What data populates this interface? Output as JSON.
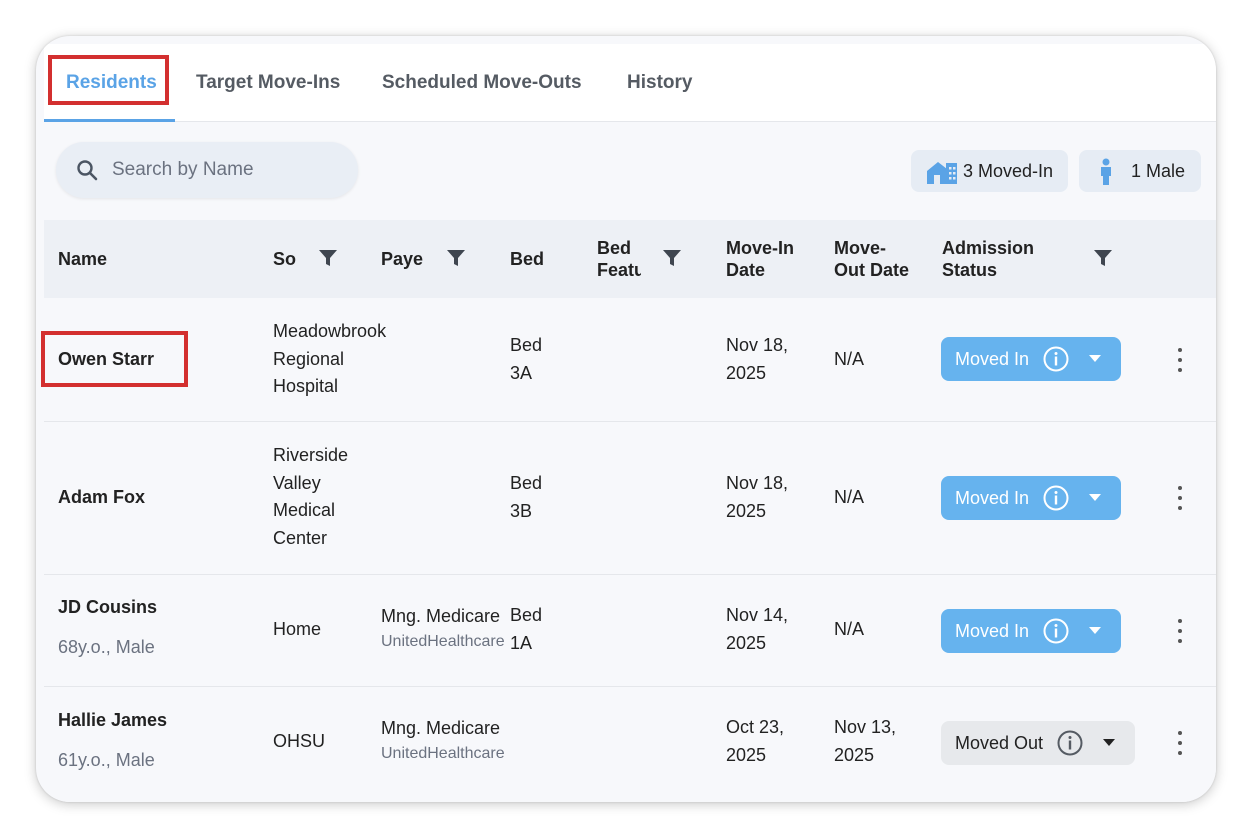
{
  "tabs": [
    {
      "label": "Residents",
      "active": true
    },
    {
      "label": "Target Move-Ins",
      "active": false
    },
    {
      "label": "Scheduled Move-Outs",
      "active": false
    },
    {
      "label": "History",
      "active": false
    }
  ],
  "search": {
    "placeholder": "Search by Name",
    "icon": "search-icon"
  },
  "summary": {
    "moved_in": "3 Moved-In",
    "male": "1 Male"
  },
  "table": {
    "headers": {
      "name": "Name",
      "source": "So",
      "payer": "Paye",
      "bed": "Bed",
      "bed_features_1": "Bed",
      "bed_features_2": "Featu",
      "move_in_1": "Move-In",
      "move_in_2": "Date",
      "move_out_1": "Move-",
      "move_out_2": "Out Date",
      "admission_1": "Admission",
      "admission_2": "Status"
    },
    "rows": [
      {
        "name": "Owen Starr",
        "source": [
          "Meadowbrook",
          "Regional",
          "Hospital"
        ],
        "payer": "",
        "payer_sub": "",
        "bed": [
          "Bed",
          "3A"
        ],
        "move_in": [
          "Nov 18,",
          "2025"
        ],
        "move_out": [
          "N/A"
        ],
        "status": "Moved In"
      },
      {
        "name": "Adam Fox",
        "source": [
          "Riverside",
          "Valley",
          "Medical",
          "Center"
        ],
        "payer": "",
        "payer_sub": "",
        "bed": [
          "Bed",
          "3B"
        ],
        "move_in": [
          "Nov 18,",
          "2025"
        ],
        "move_out": [
          "N/A"
        ],
        "status": "Moved In"
      },
      {
        "name": "JD Cousins",
        "detail": "68y.o., Male",
        "source": [
          "Home"
        ],
        "payer": "Mng. Medicare",
        "payer_sub": "UnitedHealthcare",
        "bed": [
          "Bed",
          "1A"
        ],
        "move_in": [
          "Nov 14,",
          "2025"
        ],
        "move_out": [
          "N/A"
        ],
        "status": "Moved In"
      },
      {
        "name": "Hallie James",
        "detail": "61y.o., Male",
        "source": [
          "OHSU"
        ],
        "payer": "Mng. Medicare",
        "payer_sub": "UnitedHealthcare",
        "bed": [],
        "move_in": [
          "Oct 23,",
          "2025"
        ],
        "move_out": [
          "Nov 13,",
          "2025"
        ],
        "status": "Moved Out"
      }
    ]
  },
  "colors": {
    "accent": "#5aa3e6",
    "moved_in": "#66b3ee",
    "moved_out": "#e7e9ec",
    "highlight": "#d32f2f"
  }
}
